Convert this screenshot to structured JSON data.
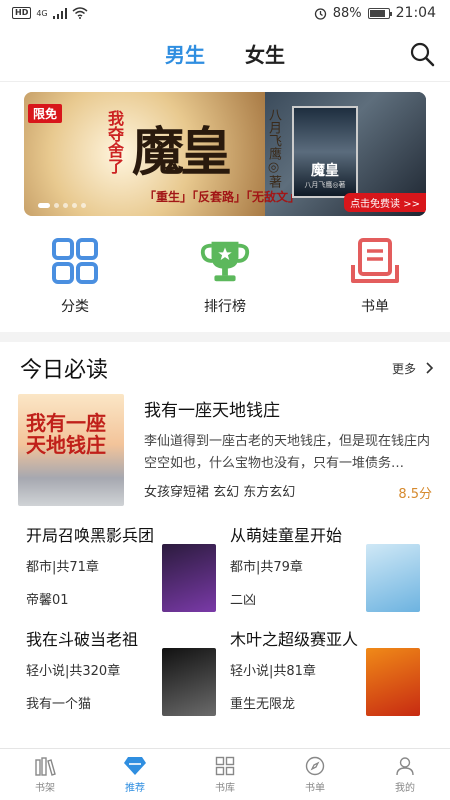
{
  "status_bar": {
    "network": "4G",
    "battery": "88%",
    "battery_level": 0.88,
    "time": "21:04"
  },
  "header": {
    "tabs": [
      {
        "label": "男生",
        "active": true
      },
      {
        "label": "女生",
        "active": false
      }
    ]
  },
  "banner": {
    "limit_label": "限免",
    "tagline": "我夺舍了",
    "title": "魔皇",
    "author": "八月飞鹰◎著",
    "keywords": "「重生」「反套路」「无敌文」",
    "cover_title": "魔皇",
    "cover_author": "八月飞鹰◎著",
    "cta": "点击免费读 >>"
  },
  "quick_nav": [
    {
      "label": "分类",
      "icon": "grid-icon"
    },
    {
      "label": "排行榜",
      "icon": "trophy-icon"
    },
    {
      "label": "书单",
      "icon": "booklist-icon"
    }
  ],
  "section": {
    "title": "今日必读",
    "more": "更多",
    "featured": {
      "title": "我有一座天地钱庄",
      "cover_text": "我有一座天地钱庄",
      "description": "李仙道得到一座古老的天地钱庄，但是现在钱庄内空空如也，什么宝物也没有，只有一堆债务…",
      "tags": "女孩穿短裙   玄幻   东方玄幻",
      "score": "8.5分"
    },
    "books": [
      {
        "title": "开局召唤黑影兵团",
        "meta": "都市|共71章",
        "author": "帝馨01",
        "cover_colors": [
          "#2b1b3d",
          "#7a3aa8"
        ]
      },
      {
        "title": "从萌娃童星开始",
        "meta": "都市|共79章",
        "author": "二凶",
        "cover_colors": [
          "#cfe8f6",
          "#6db3e0"
        ]
      },
      {
        "title": "我在斗破当老祖",
        "meta": "轻小说|共320章",
        "author": "我有一个猫",
        "cover_colors": [
          "#111111",
          "#6b6b6b"
        ]
      },
      {
        "title": "木叶之超级赛亚人",
        "meta": "轻小说|共81章",
        "author": "重生无限龙",
        "cover_colors": [
          "#f08a18",
          "#c72a12"
        ]
      }
    ]
  },
  "bottom_nav": [
    {
      "label": "书架",
      "icon": "bookshelf-icon",
      "active": false
    },
    {
      "label": "推荐",
      "icon": "diamond-icon",
      "active": true
    },
    {
      "label": "书库",
      "icon": "library-icon",
      "active": false
    },
    {
      "label": "书单",
      "icon": "compass-icon",
      "active": false
    },
    {
      "label": "我的",
      "icon": "profile-icon",
      "active": false
    }
  ],
  "colors": {
    "accent": "#2f8ee0",
    "score": "#d68a2e",
    "limit_red": "#d8161b",
    "grid_icon": "#4a8fe0",
    "trophy_icon": "#5cb85c",
    "booklist_icon": "#e35d5d"
  }
}
